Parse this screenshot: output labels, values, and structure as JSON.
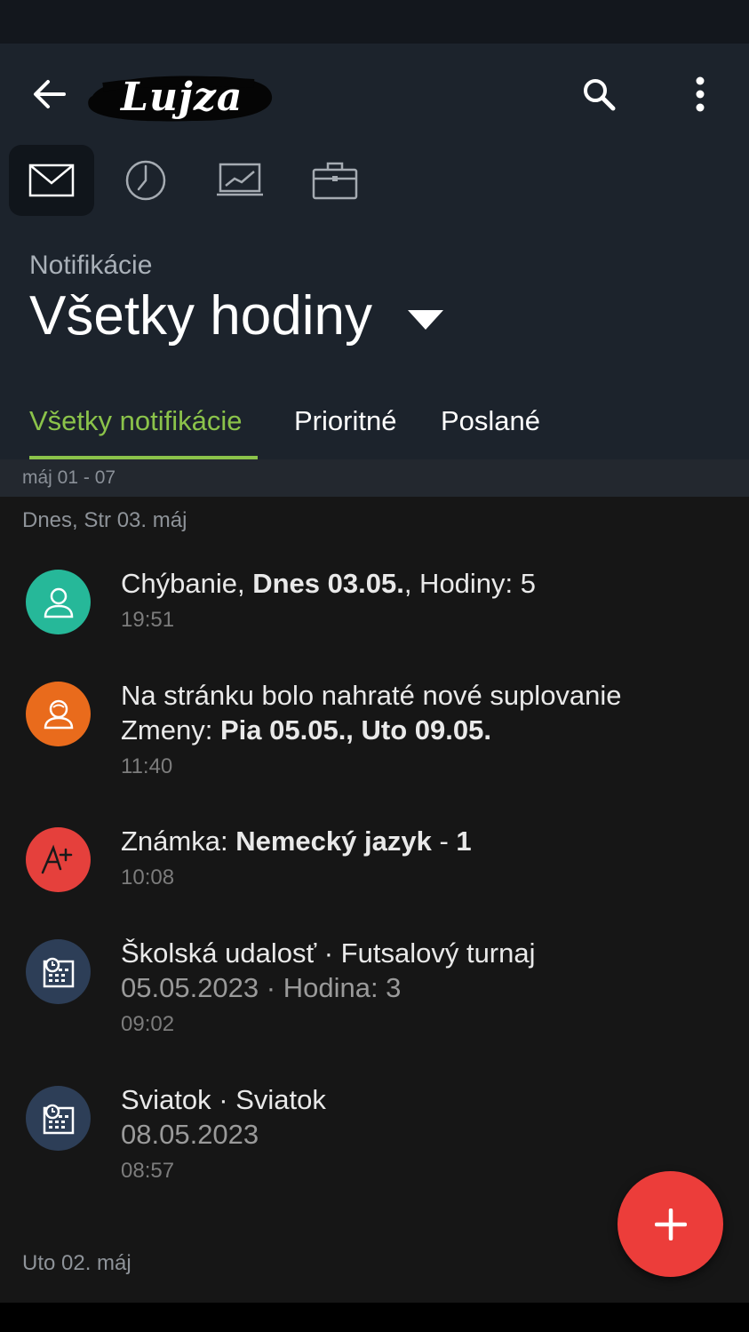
{
  "app": {
    "logo_text": "Lujza"
  },
  "header": {
    "section_label": "Notifikácie",
    "title": "Všetky hodiny"
  },
  "tabs": [
    {
      "label": "Všetky notifikácie",
      "active": true
    },
    {
      "label": "Prioritné",
      "active": false
    },
    {
      "label": "Poslané",
      "active": false
    }
  ],
  "nav_icons": [
    "mail-icon",
    "clock-icon",
    "chart-icon",
    "briefcase-icon"
  ],
  "week_range": "máj 01 - 07",
  "days": [
    {
      "header": "Dnes, Str 03. máj",
      "notifications": [
        {
          "icon": "person-icon",
          "color": "#26b899",
          "line1": {
            "pre": "Chýbanie, ",
            "bold": "Dnes 03.05.",
            "post": ", Hodiny: 5"
          },
          "time": "19:51"
        },
        {
          "icon": "substitute-icon",
          "color": "#e96b1c",
          "line1": "Na stránku bolo nahraté nové suplovanie",
          "line2": {
            "pre": "Zmeny: ",
            "bold": "Pia 05.05., Uto 09.05.",
            "post": ""
          },
          "time": "11:40"
        },
        {
          "icon": "grade-icon",
          "color": "#e5403c",
          "line1": {
            "pre": "Známka: ",
            "bold": "Nemecký jazyk",
            "post": " - ",
            "bold2": "1"
          },
          "time": "10:08"
        },
        {
          "icon": "calendar-icon",
          "color": "#2d3e57",
          "line1": "Školská udalosť · Futsalový turnaj",
          "line2": "05.05.2023 · Hodina: 3",
          "time": "09:02"
        },
        {
          "icon": "calendar-icon",
          "color": "#2d3e57",
          "line1": "Sviatok · Sviatok",
          "line2": "08.05.2023",
          "time": "08:57"
        }
      ]
    },
    {
      "header": "Uto 02. máj",
      "notifications": []
    }
  ],
  "fab": {
    "icon": "plus-icon",
    "color": "#ec3d3a"
  }
}
